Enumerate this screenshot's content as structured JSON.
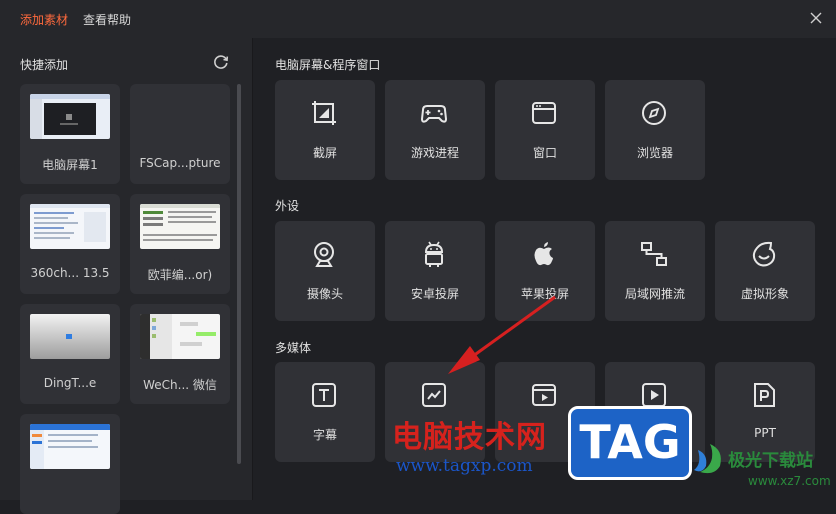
{
  "tabs": {
    "add_material": "添加素材",
    "help": "查看帮助"
  },
  "left": {
    "title": "快捷添加",
    "thumbs": [
      {
        "label": "电脑屏幕1"
      },
      {
        "label": "FSCap...pture"
      },
      {
        "label": "360ch... 13.5"
      },
      {
        "label": "欧菲编...or)"
      },
      {
        "label": "DingT...e"
      },
      {
        "label": "WeCh...  微信"
      },
      {
        "label": ""
      }
    ]
  },
  "sections": {
    "screen": {
      "title": "电脑屏幕&程序窗口",
      "items": [
        "截屏",
        "游戏进程",
        "窗口",
        "浏览器"
      ]
    },
    "peripheral": {
      "title": "外设",
      "items": [
        "摄像头",
        "安卓投屏",
        "苹果投屏",
        "局域网推流",
        "虚拟形象"
      ]
    },
    "media": {
      "title": "多媒体",
      "items": [
        "字幕",
        "",
        "",
        "",
        "PPT"
      ]
    }
  },
  "watermark": {
    "site_text": "电脑技术网",
    "site_url": "www.tagxp.com",
    "badge": "TAG",
    "xz_text": "极光下载站",
    "xz_url": "www.xz7.com"
  },
  "colors": {
    "accent": "#ff6a3d",
    "arrow": "#d62020",
    "background": "#1f2024",
    "tile": "#303136"
  }
}
